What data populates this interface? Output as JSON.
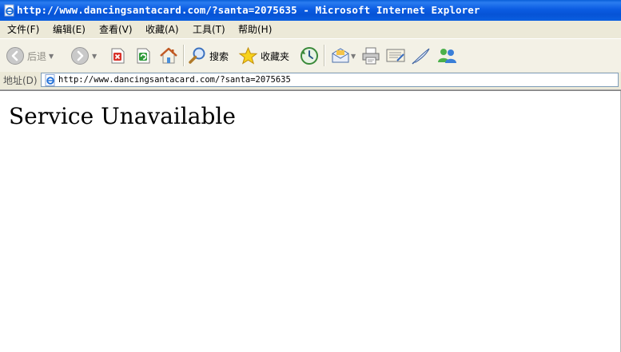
{
  "window": {
    "title": "http://www.dancingsantacard.com/?santa=2075635 - Microsoft Internet Explorer"
  },
  "menu": {
    "items": [
      "文件(F)",
      "编辑(E)",
      "查看(V)",
      "收藏(A)",
      "工具(T)",
      "帮助(H)"
    ]
  },
  "toolbar": {
    "back_label": "后退",
    "search_label": "搜索",
    "favorites_label": "收藏夹"
  },
  "address": {
    "label": "地址(D)",
    "url": "http://www.dancingsantacard.com/?santa=2075635"
  },
  "content": {
    "heading": "Service Unavailable"
  },
  "colors": {
    "titlebar": "#0a5fe0",
    "chrome": "#ece9d8"
  }
}
